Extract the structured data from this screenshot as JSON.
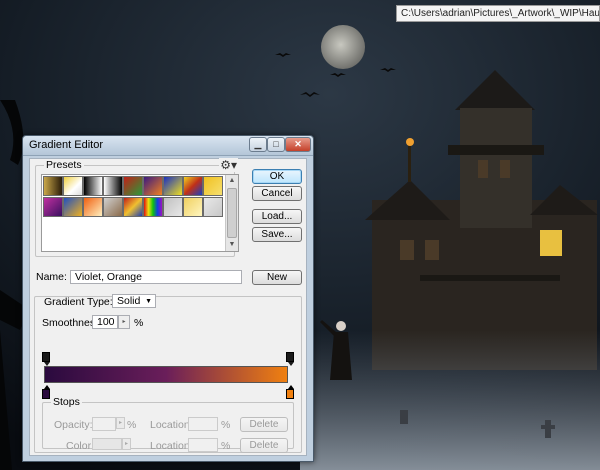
{
  "window": {
    "title": "Gradient Editor",
    "path_tooltip": "C:\\Users\\adrian\\Pictures\\_Artwork\\_WIP\\Haunted\\haunte"
  },
  "presets": {
    "label": "Presets",
    "menu_icon": "gear-icon",
    "swatches_row1": [
      "linear-gradient(90deg,#c9a74a,#2a1c08)",
      "linear-gradient(135deg,#f0d040,#fff 60%,#ddd)",
      "linear-gradient(90deg,#000,#fff)",
      "linear-gradient(90deg,#ffffff,#000000)",
      "linear-gradient(135deg,#c02018,#2a9a3a)",
      "linear-gradient(135deg,#3a1a80,#f08020)",
      "linear-gradient(135deg,#1a30c0,#f0e020)",
      "linear-gradient(135deg,#f0d020,#c03018,#1a40c0)",
      "linear-gradient(135deg,#f0c020,#f6e070)"
    ],
    "swatches_row2": [
      "linear-gradient(135deg,#c030a0,#3a1060)",
      "linear-gradient(135deg,#2050c0,#f0b020)",
      "linear-gradient(135deg,#f06010,#fff0c0)",
      "linear-gradient(135deg,#d0d0d0,#8a6a4a)",
      "linear-gradient(135deg,#c02018,#f0c030,#2040b0)",
      "linear-gradient(90deg,#e01010,#f0e010,#10c010,#1040e0,#a010c0)",
      "linear-gradient(135deg,#c0c0c0,#e8e8e8)",
      "linear-gradient(135deg,#f0d060,#fff6c0)",
      "linear-gradient(135deg,#e8e8e8,#c8c8c8)"
    ]
  },
  "buttons": {
    "ok": "OK",
    "cancel": "Cancel",
    "load": "Load...",
    "save": "Save...",
    "new": "New"
  },
  "name_field": {
    "label": "Name:",
    "value": "Violet, Orange"
  },
  "gradient": {
    "type_label": "Gradient Type:",
    "type_value": "Solid",
    "smoothness_label": "Smoothness:",
    "smoothness_value": "100",
    "smoothness_unit": "%",
    "bar_colors": [
      "#2a0a3e",
      "#6a1e5a",
      "#f08010"
    ],
    "start_color": "#2a0a3e",
    "end_color": "#f08010"
  },
  "stops": {
    "label": "Stops",
    "opacity_label": "Opacity:",
    "opacity_unit": "%",
    "location_label": "Location:",
    "location_unit": "%",
    "color_label": "Color:",
    "delete": "Delete"
  },
  "colors": {
    "dialog_frame": "#bfcfdf",
    "client": "#f0f0f0",
    "pointer_line": "#e8a030"
  }
}
